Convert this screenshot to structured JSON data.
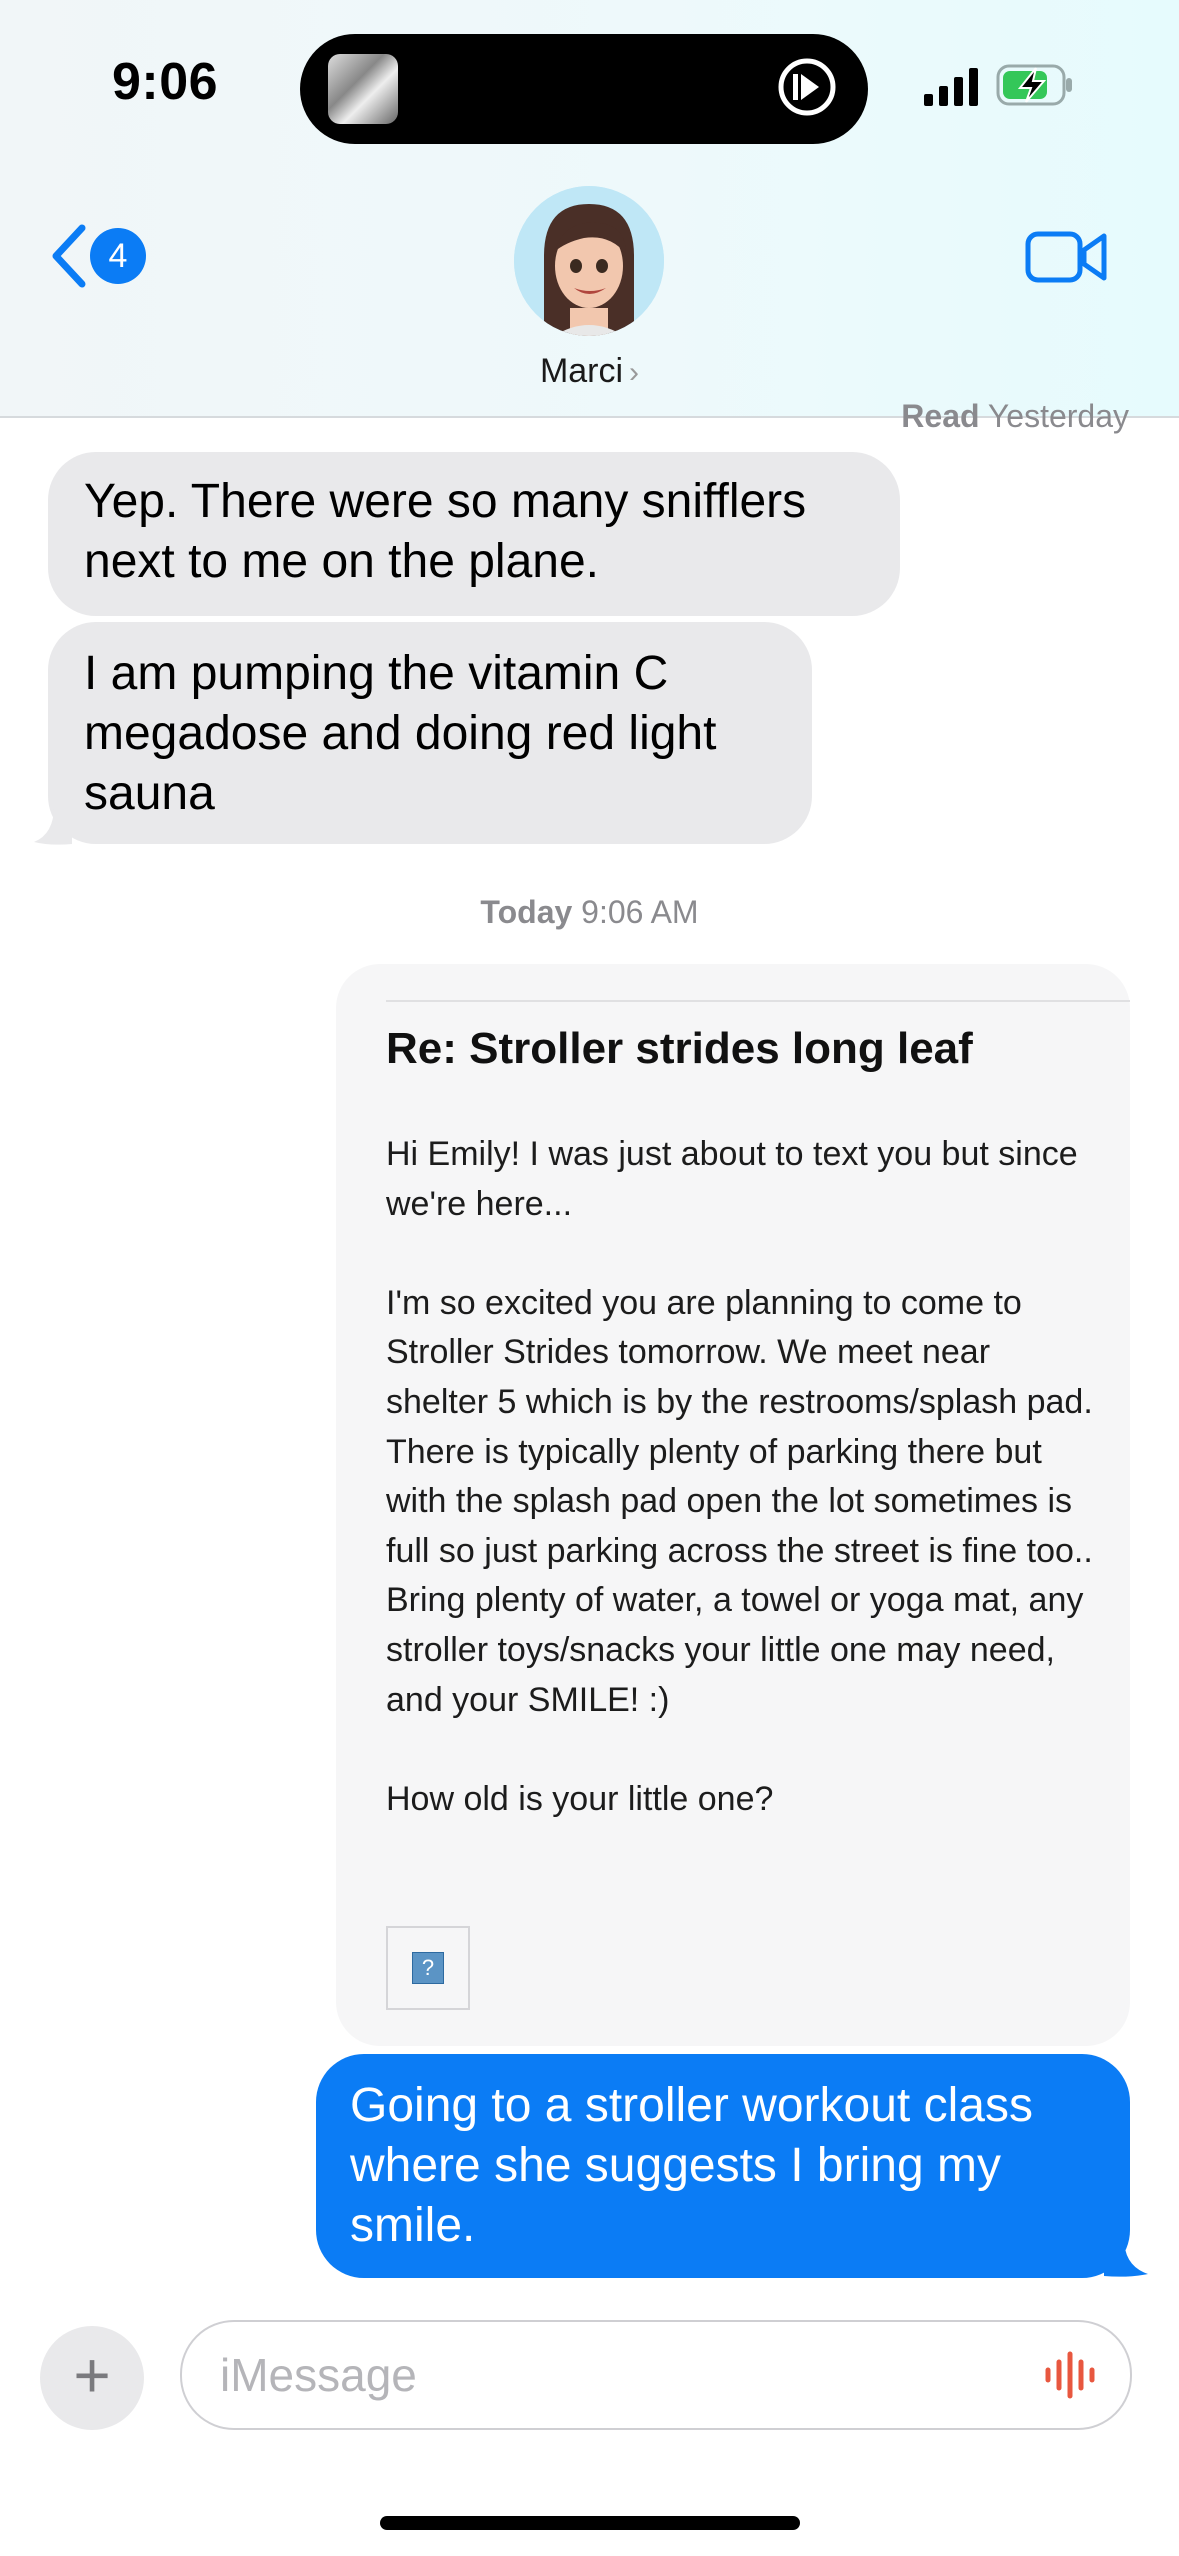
{
  "status_bar": {
    "time": "9:06"
  },
  "header": {
    "back_badge": "4",
    "contact_name": "Marci",
    "icons": {
      "back": "chevron-left-icon",
      "video": "video-camera-icon"
    }
  },
  "thread": {
    "read_receipt_label": "Read",
    "read_receipt_time": "Yesterday",
    "messages_in": [
      "Yep. There were so many snifflers next to me on the plane.",
      "I am pumping the vitamin C megadose and doing red light sauna"
    ],
    "timestamp_day": "Today",
    "timestamp_time": "9:06 AM",
    "email": {
      "subject": "Re: Stroller strides long leaf",
      "paragraphs": [
        "Hi Emily! I was just about to text you but since we're here...",
        "I'm so excited you are planning to come to Stroller Strides tomorrow. We meet near shelter 5 which is by the restrooms/splash pad. There is typically plenty of parking there but with the splash pad open the lot sometimes is full so just parking across the street is fine too.. Bring plenty of water, a towel or yoga mat, any stroller toys/snacks your little one may need, and your SMILE! :)",
        "How old is your little one?"
      ],
      "broken_image_glyph": "?"
    },
    "message_out": "Going to a stroller workout class where she suggests I bring my smile."
  },
  "composer": {
    "plus_label": "+",
    "placeholder": "iMessage"
  },
  "colors": {
    "accent": "#0b7cf5",
    "incoming_bubble": "#e9e9eb",
    "voice_icon": "#e8573f"
  }
}
